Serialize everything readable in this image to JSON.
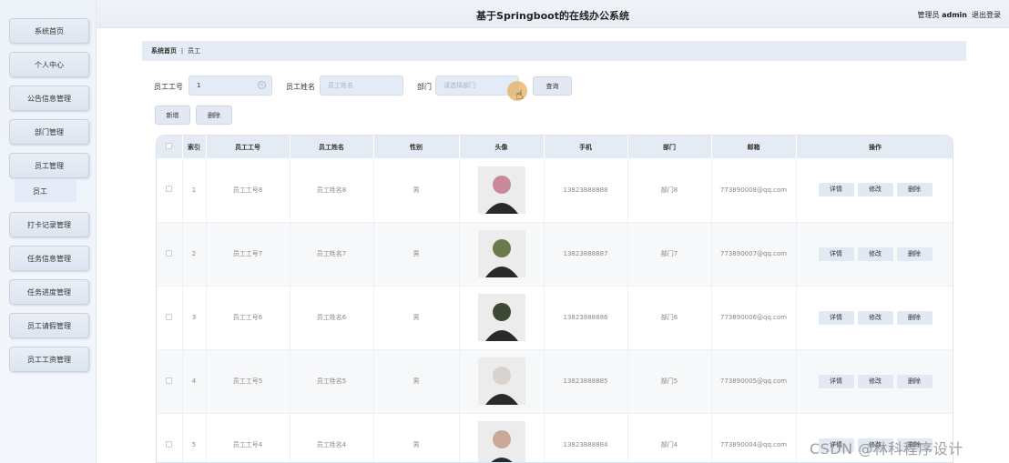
{
  "header": {
    "title": "基于Springboot的在线办公系统",
    "user_role": "管理员",
    "user_name": "admin",
    "logout": "退出登录"
  },
  "sidebar": {
    "items": [
      {
        "label": "系统首页"
      },
      {
        "label": "个人中心"
      },
      {
        "label": "公告信息管理"
      },
      {
        "label": "部门管理"
      },
      {
        "label": "员工管理"
      },
      {
        "label": "打卡记录管理"
      },
      {
        "label": "任务信息管理"
      },
      {
        "label": "任务进度管理"
      },
      {
        "label": "员工请假管理"
      },
      {
        "label": "员工工资管理"
      }
    ],
    "sub_item": "员工"
  },
  "breadcrumb": {
    "home": "系统首页",
    "separator": "ǀ",
    "current": "员工"
  },
  "search": {
    "id_label": "员工工号",
    "id_value": "1",
    "name_label": "员工姓名",
    "name_placeholder": "员工姓名",
    "dept_label": "部门",
    "dept_placeholder": "请选择部门",
    "query_button": "查询"
  },
  "actions": {
    "add": "新增",
    "delete": "删除"
  },
  "table": {
    "columns": [
      "索引",
      "员工工号",
      "员工姓名",
      "性别",
      "头像",
      "手机",
      "部门",
      "邮箱",
      "操作"
    ],
    "op_labels": [
      "详情",
      "修改",
      "删除"
    ],
    "rows": [
      {
        "index": "1",
        "id": "员工工号8",
        "name": "员工姓名8",
        "gender": "男",
        "phone": "13823888888",
        "dept": "部门8",
        "email": "773890008@qq.com",
        "avatar_color": "#c88a9a"
      },
      {
        "index": "2",
        "id": "员工工号7",
        "name": "员工姓名7",
        "gender": "男",
        "phone": "13823888887",
        "dept": "部门7",
        "email": "773890007@qq.com",
        "avatar_color": "#6b7a4a"
      },
      {
        "index": "3",
        "id": "员工工号6",
        "name": "员工姓名6",
        "gender": "男",
        "phone": "13823888886",
        "dept": "部门6",
        "email": "773890006@qq.com",
        "avatar_color": "#3c4a34"
      },
      {
        "index": "4",
        "id": "员工工号5",
        "name": "员工姓名5",
        "gender": "男",
        "phone": "13823888885",
        "dept": "部门5",
        "email": "773890005@qq.com",
        "avatar_color": "#d9d3cf"
      },
      {
        "index": "5",
        "id": "员工工号4",
        "name": "员工姓名4",
        "gender": "男",
        "phone": "13823888884",
        "dept": "部门4",
        "email": "773890004@qq.com",
        "avatar_color": "#c9a898"
      }
    ]
  },
  "watermark": "CSDN @林科程序设计"
}
